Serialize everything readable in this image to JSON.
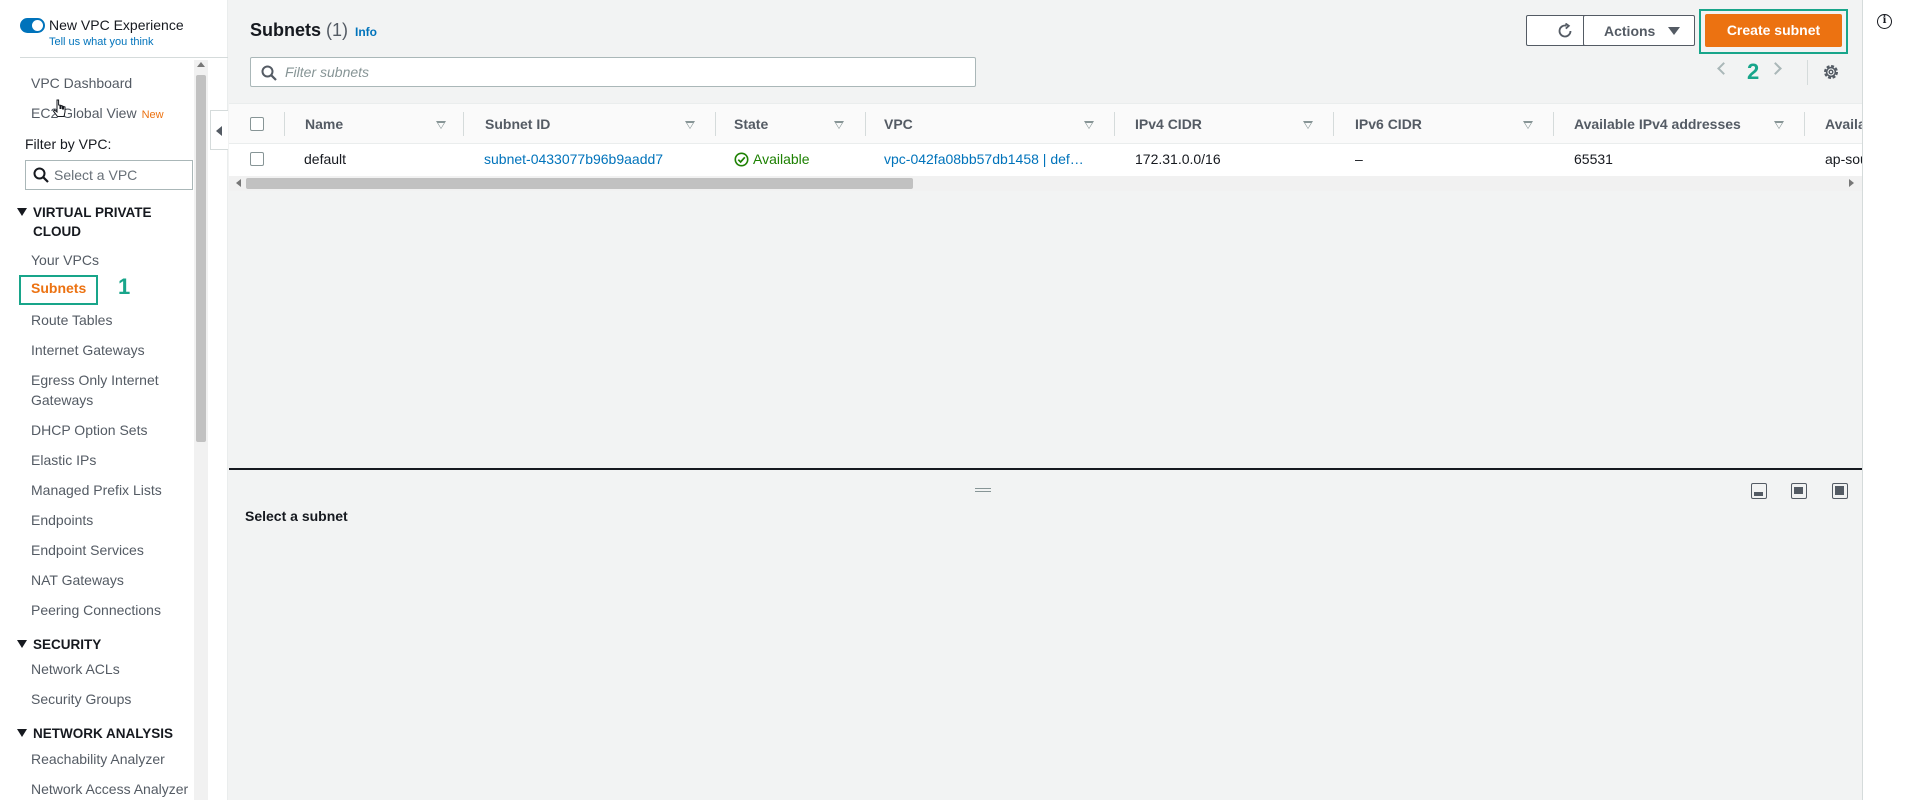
{
  "sidebar": {
    "experience_label": "New VPC Experience",
    "experience_link": "Tell us what you think",
    "dashboard": "VPC Dashboard",
    "global_view": "EC2 Global View",
    "global_view_badge": "New",
    "filter_label": "Filter by VPC:",
    "filter_placeholder": "Select a VPC",
    "sections": {
      "vpc": "VIRTUAL PRIVATE CLOUD",
      "security": "SECURITY",
      "network_analysis": "NETWORK ANALYSIS"
    },
    "vpc_items": [
      "Your VPCs",
      "Subnets",
      "Route Tables",
      "Internet Gateways",
      "Egress Only Internet Gateways",
      "DHCP Option Sets",
      "Elastic IPs",
      "Managed Prefix Lists",
      "Endpoints",
      "Endpoint Services",
      "NAT Gateways",
      "Peering Connections"
    ],
    "security_items": [
      "Network ACLs",
      "Security Groups"
    ],
    "analysis_items": [
      "Reachability Analyzer",
      "Network Access Analyzer"
    ],
    "step_marker": "1"
  },
  "header": {
    "title": "Subnets",
    "count": "(1)",
    "info": "Info",
    "actions_label": "Actions",
    "create_label": "Create subnet",
    "step_marker": "2"
  },
  "filter": {
    "placeholder": "Filter subnets"
  },
  "table": {
    "columns": [
      "Name",
      "Subnet ID",
      "State",
      "VPC",
      "IPv4 CIDR",
      "IPv6 CIDR",
      "Available IPv4 addresses",
      "Availa"
    ],
    "rows": [
      {
        "name": "default",
        "subnet_id": "subnet-0433077b96b9aadd7",
        "state": "Available",
        "vpc": "vpc-042fa08bb57db1458 | def…",
        "ipv4_cidr": "172.31.0.0/16",
        "ipv6_cidr": "–",
        "available_ipv4": "65531",
        "availability_zone": "ap-sou"
      }
    ]
  },
  "split_panel": {
    "title": "Select a subnet"
  },
  "colors": {
    "accent": "#ec7211",
    "link": "#0073bb",
    "highlight": "#18a58a",
    "success": "#1d8102"
  },
  "icons": [
    "search-icon",
    "refresh-icon",
    "caret-down-icon",
    "gear-icon",
    "check-circle-icon",
    "info-icon",
    "chevron-left-icon",
    "chevron-right-icon"
  ]
}
